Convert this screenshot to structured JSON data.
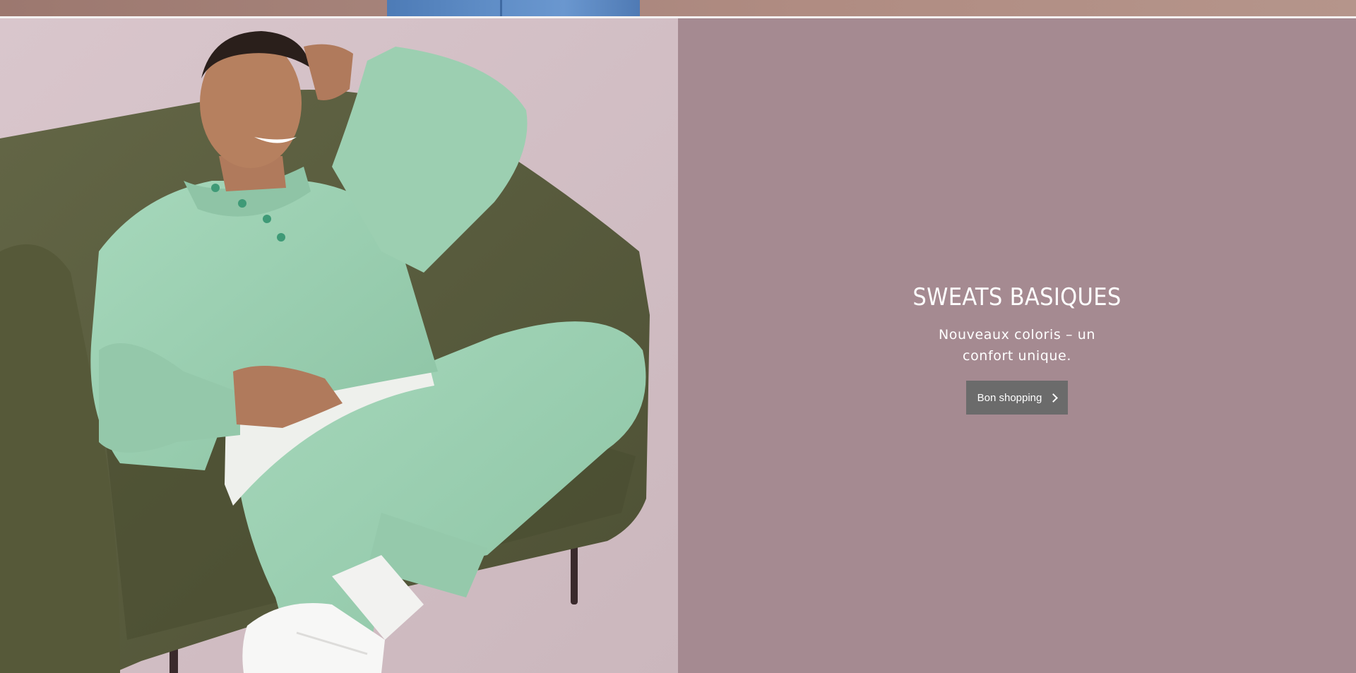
{
  "promo": {
    "title": "SWEATS BASIQUES",
    "subtitle": "Nouveaux coloris – un confort unique.",
    "cta_label": "Bon shopping",
    "cta_icon": "chevron-right-icon"
  },
  "colors": {
    "promo_background": "#a58a91",
    "image_background": "#d4c1c7",
    "button_background": "#6b6b6b",
    "sweatsuit": "#9dcfb1",
    "armchair": "#5b5e3e"
  }
}
